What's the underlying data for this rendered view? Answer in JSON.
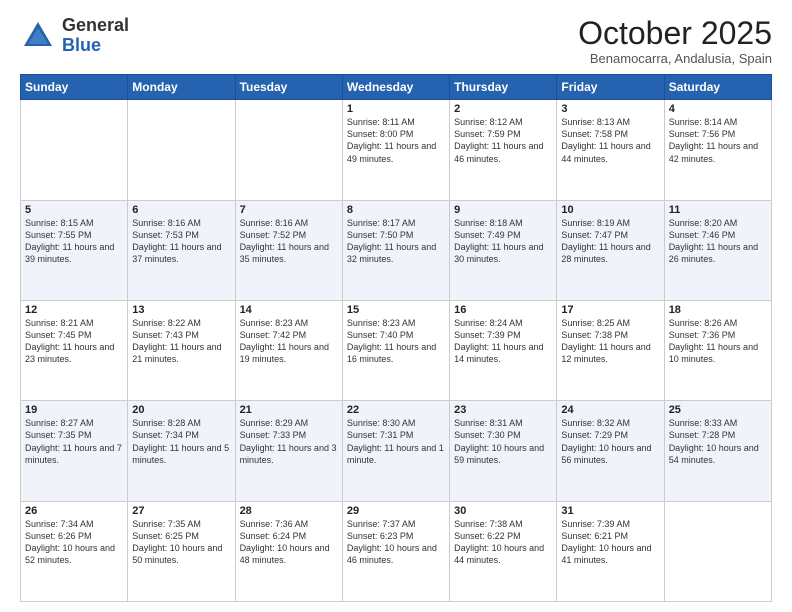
{
  "header": {
    "logo_general": "General",
    "logo_blue": "Blue",
    "month_title": "October 2025",
    "location": "Benamocarra, Andalusia, Spain"
  },
  "weekdays": [
    "Sunday",
    "Monday",
    "Tuesday",
    "Wednesday",
    "Thursday",
    "Friday",
    "Saturday"
  ],
  "weeks": [
    [
      {
        "day": "",
        "sunrise": "",
        "sunset": "",
        "daylight": ""
      },
      {
        "day": "",
        "sunrise": "",
        "sunset": "",
        "daylight": ""
      },
      {
        "day": "",
        "sunrise": "",
        "sunset": "",
        "daylight": ""
      },
      {
        "day": "1",
        "sunrise": "Sunrise: 8:11 AM",
        "sunset": "Sunset: 8:00 PM",
        "daylight": "Daylight: 11 hours and 49 minutes."
      },
      {
        "day": "2",
        "sunrise": "Sunrise: 8:12 AM",
        "sunset": "Sunset: 7:59 PM",
        "daylight": "Daylight: 11 hours and 46 minutes."
      },
      {
        "day": "3",
        "sunrise": "Sunrise: 8:13 AM",
        "sunset": "Sunset: 7:58 PM",
        "daylight": "Daylight: 11 hours and 44 minutes."
      },
      {
        "day": "4",
        "sunrise": "Sunrise: 8:14 AM",
        "sunset": "Sunset: 7:56 PM",
        "daylight": "Daylight: 11 hours and 42 minutes."
      }
    ],
    [
      {
        "day": "5",
        "sunrise": "Sunrise: 8:15 AM",
        "sunset": "Sunset: 7:55 PM",
        "daylight": "Daylight: 11 hours and 39 minutes."
      },
      {
        "day": "6",
        "sunrise": "Sunrise: 8:16 AM",
        "sunset": "Sunset: 7:53 PM",
        "daylight": "Daylight: 11 hours and 37 minutes."
      },
      {
        "day": "7",
        "sunrise": "Sunrise: 8:16 AM",
        "sunset": "Sunset: 7:52 PM",
        "daylight": "Daylight: 11 hours and 35 minutes."
      },
      {
        "day": "8",
        "sunrise": "Sunrise: 8:17 AM",
        "sunset": "Sunset: 7:50 PM",
        "daylight": "Daylight: 11 hours and 32 minutes."
      },
      {
        "day": "9",
        "sunrise": "Sunrise: 8:18 AM",
        "sunset": "Sunset: 7:49 PM",
        "daylight": "Daylight: 11 hours and 30 minutes."
      },
      {
        "day": "10",
        "sunrise": "Sunrise: 8:19 AM",
        "sunset": "Sunset: 7:47 PM",
        "daylight": "Daylight: 11 hours and 28 minutes."
      },
      {
        "day": "11",
        "sunrise": "Sunrise: 8:20 AM",
        "sunset": "Sunset: 7:46 PM",
        "daylight": "Daylight: 11 hours and 26 minutes."
      }
    ],
    [
      {
        "day": "12",
        "sunrise": "Sunrise: 8:21 AM",
        "sunset": "Sunset: 7:45 PM",
        "daylight": "Daylight: 11 hours and 23 minutes."
      },
      {
        "day": "13",
        "sunrise": "Sunrise: 8:22 AM",
        "sunset": "Sunset: 7:43 PM",
        "daylight": "Daylight: 11 hours and 21 minutes."
      },
      {
        "day": "14",
        "sunrise": "Sunrise: 8:23 AM",
        "sunset": "Sunset: 7:42 PM",
        "daylight": "Daylight: 11 hours and 19 minutes."
      },
      {
        "day": "15",
        "sunrise": "Sunrise: 8:23 AM",
        "sunset": "Sunset: 7:40 PM",
        "daylight": "Daylight: 11 hours and 16 minutes."
      },
      {
        "day": "16",
        "sunrise": "Sunrise: 8:24 AM",
        "sunset": "Sunset: 7:39 PM",
        "daylight": "Daylight: 11 hours and 14 minutes."
      },
      {
        "day": "17",
        "sunrise": "Sunrise: 8:25 AM",
        "sunset": "Sunset: 7:38 PM",
        "daylight": "Daylight: 11 hours and 12 minutes."
      },
      {
        "day": "18",
        "sunrise": "Sunrise: 8:26 AM",
        "sunset": "Sunset: 7:36 PM",
        "daylight": "Daylight: 11 hours and 10 minutes."
      }
    ],
    [
      {
        "day": "19",
        "sunrise": "Sunrise: 8:27 AM",
        "sunset": "Sunset: 7:35 PM",
        "daylight": "Daylight: 11 hours and 7 minutes."
      },
      {
        "day": "20",
        "sunrise": "Sunrise: 8:28 AM",
        "sunset": "Sunset: 7:34 PM",
        "daylight": "Daylight: 11 hours and 5 minutes."
      },
      {
        "day": "21",
        "sunrise": "Sunrise: 8:29 AM",
        "sunset": "Sunset: 7:33 PM",
        "daylight": "Daylight: 11 hours and 3 minutes."
      },
      {
        "day": "22",
        "sunrise": "Sunrise: 8:30 AM",
        "sunset": "Sunset: 7:31 PM",
        "daylight": "Daylight: 11 hours and 1 minute."
      },
      {
        "day": "23",
        "sunrise": "Sunrise: 8:31 AM",
        "sunset": "Sunset: 7:30 PM",
        "daylight": "Daylight: 10 hours and 59 minutes."
      },
      {
        "day": "24",
        "sunrise": "Sunrise: 8:32 AM",
        "sunset": "Sunset: 7:29 PM",
        "daylight": "Daylight: 10 hours and 56 minutes."
      },
      {
        "day": "25",
        "sunrise": "Sunrise: 8:33 AM",
        "sunset": "Sunset: 7:28 PM",
        "daylight": "Daylight: 10 hours and 54 minutes."
      }
    ],
    [
      {
        "day": "26",
        "sunrise": "Sunrise: 7:34 AM",
        "sunset": "Sunset: 6:26 PM",
        "daylight": "Daylight: 10 hours and 52 minutes."
      },
      {
        "day": "27",
        "sunrise": "Sunrise: 7:35 AM",
        "sunset": "Sunset: 6:25 PM",
        "daylight": "Daylight: 10 hours and 50 minutes."
      },
      {
        "day": "28",
        "sunrise": "Sunrise: 7:36 AM",
        "sunset": "Sunset: 6:24 PM",
        "daylight": "Daylight: 10 hours and 48 minutes."
      },
      {
        "day": "29",
        "sunrise": "Sunrise: 7:37 AM",
        "sunset": "Sunset: 6:23 PM",
        "daylight": "Daylight: 10 hours and 46 minutes."
      },
      {
        "day": "30",
        "sunrise": "Sunrise: 7:38 AM",
        "sunset": "Sunset: 6:22 PM",
        "daylight": "Daylight: 10 hours and 44 minutes."
      },
      {
        "day": "31",
        "sunrise": "Sunrise: 7:39 AM",
        "sunset": "Sunset: 6:21 PM",
        "daylight": "Daylight: 10 hours and 41 minutes."
      },
      {
        "day": "",
        "sunrise": "",
        "sunset": "",
        "daylight": ""
      }
    ]
  ]
}
